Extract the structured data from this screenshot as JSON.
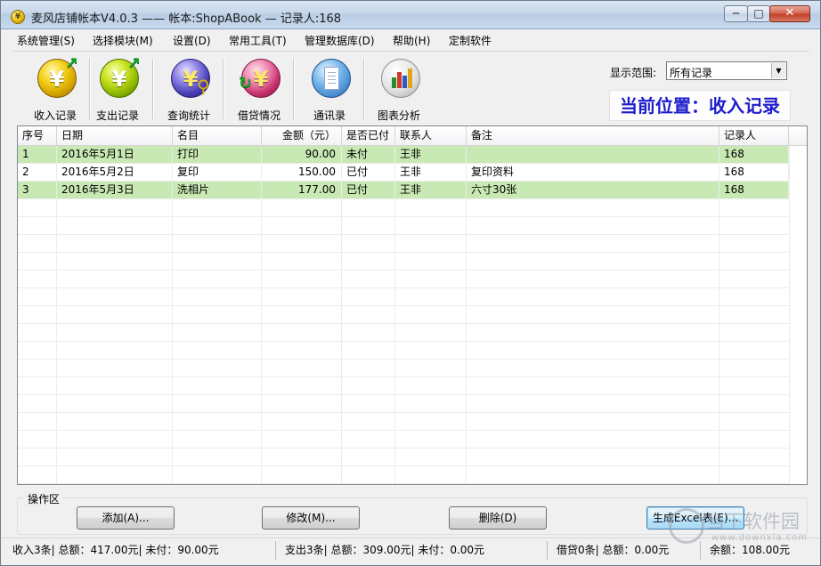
{
  "window": {
    "title": "麦风店铺帐本V4.0.3  ——  帐本:ShopABook — 记录人:168",
    "app_icon_glyph": "¥",
    "min_glyph": "─",
    "max_glyph": "□",
    "close_glyph": "✕"
  },
  "menu": [
    {
      "label": "系统管理(S)"
    },
    {
      "label": "选择模块(M)"
    },
    {
      "label": "设置(D)"
    },
    {
      "label": "常用工具(T)"
    },
    {
      "label": "管理数据库(D)"
    },
    {
      "label": "帮助(H)"
    },
    {
      "label": "定制软件"
    }
  ],
  "toolbar": [
    {
      "label": "收入记录",
      "icon": "income-record-icon"
    },
    {
      "label": "支出记录",
      "icon": "expense-record-icon"
    },
    {
      "label": "查询统计",
      "icon": "query-stats-icon"
    },
    {
      "label": "借贷情况",
      "icon": "loan-status-icon"
    },
    {
      "label": "通讯录",
      "icon": "address-book-icon"
    },
    {
      "label": "图表分析",
      "icon": "chart-analysis-icon"
    }
  ],
  "display_range": {
    "label": "显示范围:",
    "value": "所有记录"
  },
  "current_location": "当前位置：收入记录",
  "grid": {
    "columns": [
      "序号",
      "日期",
      "名目",
      "金额（元）",
      "是否已付",
      "联系人",
      "备注",
      "记录人"
    ],
    "rows": [
      {
        "seq": "1",
        "date": "2016年5月1日",
        "item": "打印",
        "amount": "90.00",
        "paid": "未付",
        "contact": "王非",
        "note": "",
        "recorder": "168"
      },
      {
        "seq": "2",
        "date": "2016年5月2日",
        "item": "复印",
        "amount": "150.00",
        "paid": "已付",
        "contact": "王非",
        "note": "复印资料",
        "recorder": "168"
      },
      {
        "seq": "3",
        "date": "2016年5月3日",
        "item": "洗相片",
        "amount": "177.00",
        "paid": "已付",
        "contact": "王非",
        "note": "六寸30张",
        "recorder": "168"
      }
    ],
    "row_highlight": "#c9e9b4"
  },
  "operations": {
    "group_label": "操作区",
    "add": "添加(A)...",
    "edit": "修改(M)...",
    "delete": "删除(D)",
    "export": "生成Excel表(E)..."
  },
  "status": {
    "income": "收入3条| 总额：417.00元| 未付：90.00元",
    "expense": "支出3条| 总额：309.00元| 未付：0.00元",
    "loan": "借贷0条| 总额：0.00元",
    "balance": "余额：108.00元"
  },
  "watermark": {
    "text": "当下软件园",
    "url": "www.downxia.com"
  },
  "colors": {
    "location_text": "#1d1dcc",
    "row_green": "#c9e9b4"
  }
}
